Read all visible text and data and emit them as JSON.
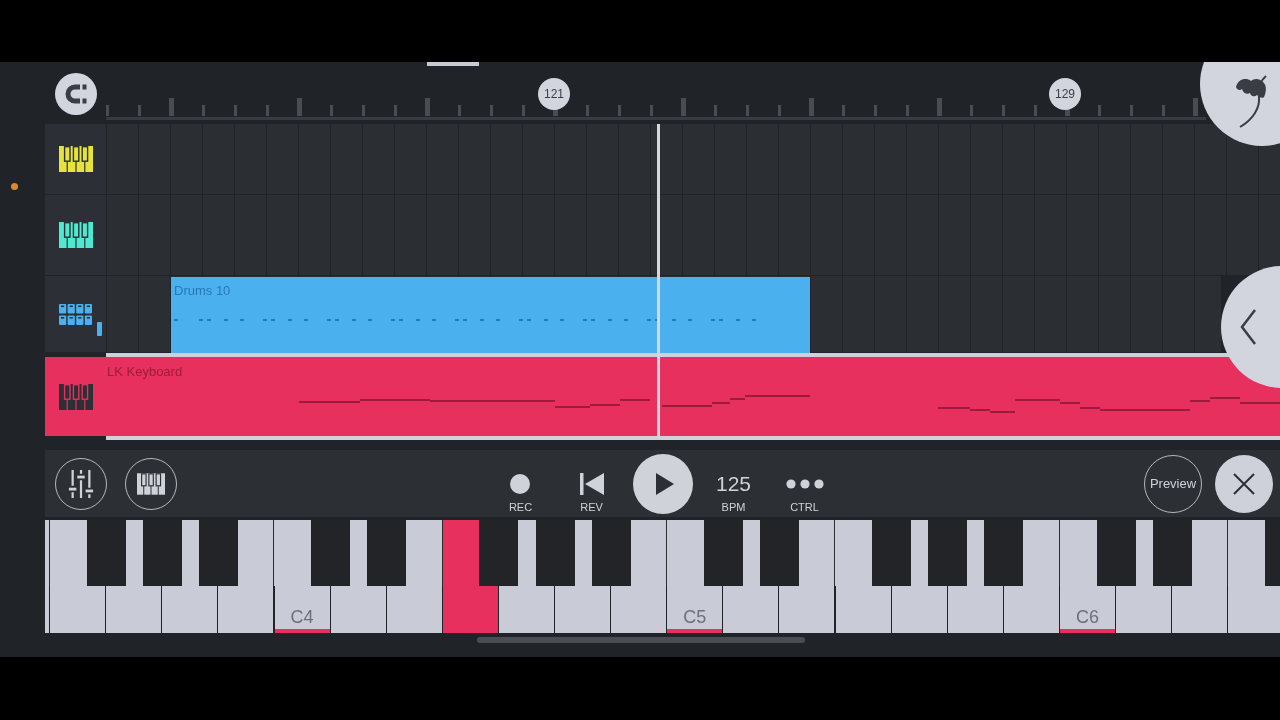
{
  "ruler": {
    "snap_button": {
      "kind": "magnet"
    },
    "bar_markers": [
      "121",
      "129"
    ]
  },
  "tracks": [
    {
      "kind": "instrument",
      "color": "#e7e33c",
      "selected": false
    },
    {
      "kind": "instrument",
      "color": "#4fe9d2",
      "selected": false
    },
    {
      "kind": "drums",
      "color": "#4bb0ee",
      "selected": false,
      "clips": [
        {
          "label": "Drums 10"
        }
      ]
    },
    {
      "kind": "instrument",
      "color": "#e8305e",
      "selected": true,
      "clips": [
        {
          "label": "LK Keyboard"
        }
      ]
    }
  ],
  "overlay_buttons": [
    {
      "kind": "logo"
    },
    {
      "kind": "collapse"
    }
  ],
  "transport": {
    "left_buttons": [
      {
        "kind": "mixer"
      },
      {
        "kind": "piano"
      }
    ],
    "controls": [
      {
        "kind": "record",
        "label": "REC"
      },
      {
        "kind": "rewind",
        "label": "REV"
      },
      {
        "kind": "play"
      },
      {
        "kind": "tempo",
        "value": "125",
        "label": "BPM"
      },
      {
        "kind": "more",
        "label": "CTRL"
      }
    ],
    "right_buttons": [
      {
        "kind": "text",
        "label": "Preview"
      },
      {
        "kind": "close"
      }
    ]
  },
  "keyboard": {
    "keys": [
      {
        "kind": "white",
        "pressed": false
      },
      {
        "kind": "white",
        "pressed": false
      },
      {
        "kind": "black",
        "pressed": false
      },
      {
        "kind": "white",
        "pressed": false
      },
      {
        "kind": "black",
        "pressed": false
      },
      {
        "kind": "white",
        "pressed": false
      },
      {
        "kind": "black",
        "pressed": false
      },
      {
        "kind": "white",
        "pressed": false
      },
      {
        "kind": "white",
        "pressed": false,
        "label": "C4"
      },
      {
        "kind": "black",
        "pressed": false
      },
      {
        "kind": "white",
        "pressed": false
      },
      {
        "kind": "black",
        "pressed": false
      },
      {
        "kind": "white",
        "pressed": false
      },
      {
        "kind": "white",
        "pressed": true
      },
      {
        "kind": "black",
        "pressed": false
      },
      {
        "kind": "white",
        "pressed": false
      },
      {
        "kind": "black",
        "pressed": false
      },
      {
        "kind": "white",
        "pressed": false
      },
      {
        "kind": "black",
        "pressed": false
      },
      {
        "kind": "white",
        "pressed": false
      },
      {
        "kind": "white",
        "pressed": false,
        "label": "C5"
      },
      {
        "kind": "black",
        "pressed": false
      },
      {
        "kind": "white",
        "pressed": false
      },
      {
        "kind": "black",
        "pressed": false
      },
      {
        "kind": "white",
        "pressed": false
      },
      {
        "kind": "white",
        "pressed": false
      },
      {
        "kind": "black",
        "pressed": false
      },
      {
        "kind": "white",
        "pressed": false
      },
      {
        "kind": "black",
        "pressed": false
      },
      {
        "kind": "white",
        "pressed": false
      },
      {
        "kind": "black",
        "pressed": false
      },
      {
        "kind": "white",
        "pressed": false
      },
      {
        "kind": "white",
        "pressed": false,
        "label": "C6"
      },
      {
        "kind": "black",
        "pressed": false
      },
      {
        "kind": "white",
        "pressed": false
      },
      {
        "kind": "black",
        "pressed": false
      },
      {
        "kind": "white",
        "pressed": false
      },
      {
        "kind": "white",
        "pressed": false
      },
      {
        "kind": "black",
        "pressed": false
      }
    ]
  }
}
